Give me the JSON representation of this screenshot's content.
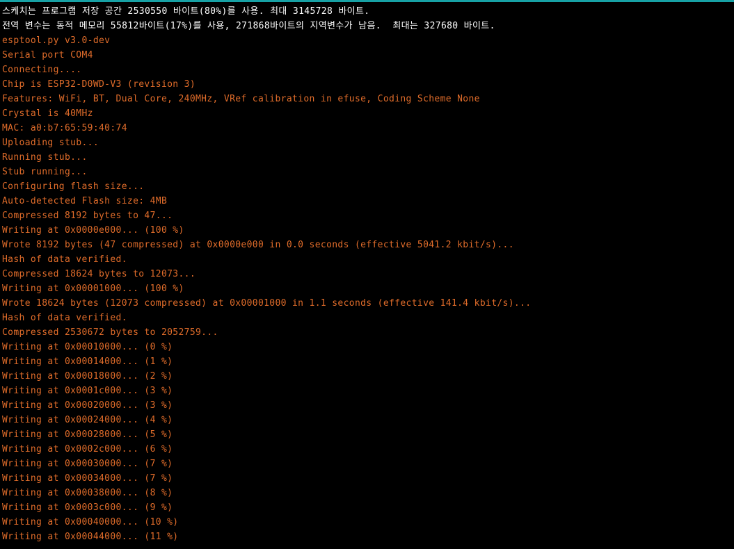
{
  "console": {
    "accent_color": "#17a1a5",
    "info_color": "#ffffff",
    "output_color": "#e06c2a",
    "lines": [
      {
        "text": "스케치는 프로그램 저장 공간 2530550 바이트(80%)를 사용. 최대 3145728 바이트.",
        "kind": "info"
      },
      {
        "text": "전역 변수는 동적 메모리 55812바이트(17%)를 사용, 271868바이트의 지역변수가 남음.  최대는 327680 바이트.",
        "kind": "info"
      },
      {
        "text": "esptool.py v3.0-dev",
        "kind": "output"
      },
      {
        "text": "Serial port COM4",
        "kind": "output"
      },
      {
        "text": "Connecting....",
        "kind": "output"
      },
      {
        "text": "Chip is ESP32-D0WD-V3 (revision 3)",
        "kind": "output"
      },
      {
        "text": "Features: WiFi, BT, Dual Core, 240MHz, VRef calibration in efuse, Coding Scheme None",
        "kind": "output"
      },
      {
        "text": "Crystal is 40MHz",
        "kind": "output"
      },
      {
        "text": "MAC: a0:b7:65:59:40:74",
        "kind": "output"
      },
      {
        "text": "Uploading stub...",
        "kind": "output"
      },
      {
        "text": "Running stub...",
        "kind": "output"
      },
      {
        "text": "Stub running...",
        "kind": "output"
      },
      {
        "text": "Configuring flash size...",
        "kind": "output"
      },
      {
        "text": "Auto-detected Flash size: 4MB",
        "kind": "output"
      },
      {
        "text": "Compressed 8192 bytes to 47...",
        "kind": "output"
      },
      {
        "text": "Writing at 0x0000e000... (100 %)",
        "kind": "output"
      },
      {
        "text": "Wrote 8192 bytes (47 compressed) at 0x0000e000 in 0.0 seconds (effective 5041.2 kbit/s)...",
        "kind": "output"
      },
      {
        "text": "Hash of data verified.",
        "kind": "output"
      },
      {
        "text": "Compressed 18624 bytes to 12073...",
        "kind": "output"
      },
      {
        "text": "Writing at 0x00001000... (100 %)",
        "kind": "output"
      },
      {
        "text": "Wrote 18624 bytes (12073 compressed) at 0x00001000 in 1.1 seconds (effective 141.4 kbit/s)...",
        "kind": "output"
      },
      {
        "text": "Hash of data verified.",
        "kind": "output"
      },
      {
        "text": "Compressed 2530672 bytes to 2052759...",
        "kind": "output"
      },
      {
        "text": "Writing at 0x00010000... (0 %)",
        "kind": "output"
      },
      {
        "text": "Writing at 0x00014000... (1 %)",
        "kind": "output"
      },
      {
        "text": "Writing at 0x00018000... (2 %)",
        "kind": "output"
      },
      {
        "text": "Writing at 0x0001c000... (3 %)",
        "kind": "output"
      },
      {
        "text": "Writing at 0x00020000... (3 %)",
        "kind": "output"
      },
      {
        "text": "Writing at 0x00024000... (4 %)",
        "kind": "output"
      },
      {
        "text": "Writing at 0x00028000... (5 %)",
        "kind": "output"
      },
      {
        "text": "Writing at 0x0002c000... (6 %)",
        "kind": "output"
      },
      {
        "text": "Writing at 0x00030000... (7 %)",
        "kind": "output"
      },
      {
        "text": "Writing at 0x00034000... (7 %)",
        "kind": "output"
      },
      {
        "text": "Writing at 0x00038000... (8 %)",
        "kind": "output"
      },
      {
        "text": "Writing at 0x0003c000... (9 %)",
        "kind": "output"
      },
      {
        "text": "Writing at 0x00040000... (10 %)",
        "kind": "output"
      },
      {
        "text": "Writing at 0x00044000... (11 %)",
        "kind": "output"
      }
    ]
  }
}
